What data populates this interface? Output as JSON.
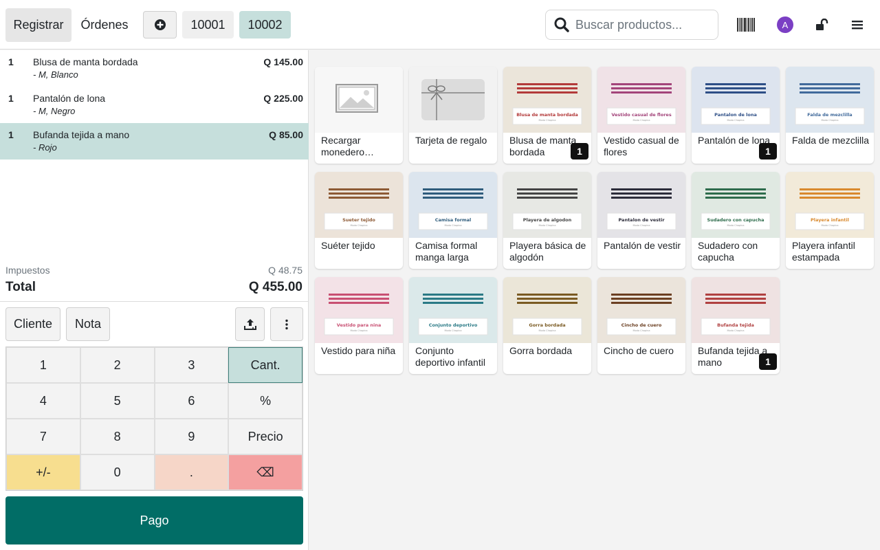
{
  "header": {
    "register_label": "Registrar",
    "orders_label": "Órdenes",
    "order_tabs": [
      "10001",
      "10002"
    ],
    "search_placeholder": "Buscar productos...",
    "avatar_initial": "A"
  },
  "order": {
    "lines": [
      {
        "qty": "1",
        "name": "Blusa de manta bordada",
        "attrs": "- M, Blanco",
        "price": "Q 145.00",
        "selected": false
      },
      {
        "qty": "1",
        "name": "Pantalón de lona",
        "attrs": "- M, Negro",
        "price": "Q 225.00",
        "selected": false
      },
      {
        "qty": "1",
        "name": "Bufanda tejida a mano",
        "attrs": "- Rojo",
        "price": "Q 85.00",
        "selected": true
      }
    ],
    "tax_label": "Impuestos",
    "tax_value": "Q 48.75",
    "total_label": "Total",
    "total_value": "Q 455.00"
  },
  "controls": {
    "customer_label": "Cliente",
    "note_label": "Nota"
  },
  "numpad": {
    "keys": [
      "1",
      "2",
      "3",
      "Cant.",
      "4",
      "5",
      "6",
      "%",
      "7",
      "8",
      "9",
      "Precio",
      "+/-",
      "0",
      ".",
      "⌫"
    ]
  },
  "pay_label": "Pago",
  "products": [
    {
      "name": "Recargar monedero…",
      "thumb_text": "",
      "accent": "",
      "qty_badge": ""
    },
    {
      "name": "Tarjeta de regalo",
      "thumb_text": "",
      "accent": "",
      "qty_badge": ""
    },
    {
      "name": "Blusa de manta bordada",
      "thumb_text": "Blusa de manta bordada",
      "accent": "#b33a3a",
      "bg": "#ebe5da",
      "qty_badge": "1"
    },
    {
      "name": "Vestido casual de flores",
      "thumb_text": "Vestido casual de flores",
      "accent": "#a3447a",
      "bg": "#f0e2e7",
      "qty_badge": ""
    },
    {
      "name": "Pantalón de lona",
      "thumb_text": "Pantalon de lona",
      "accent": "#2d4e86",
      "bg": "#dde4ef",
      "qty_badge": "1"
    },
    {
      "name": "Falda de mezclilla",
      "thumb_text": "Falda de mezclilla",
      "accent": "#416a9b",
      "bg": "#dde6ef",
      "qty_badge": ""
    },
    {
      "name": "Suéter tejido",
      "thumb_text": "Sueter tejido",
      "accent": "#8d5a35",
      "bg": "#ece3d9",
      "qty_badge": ""
    },
    {
      "name": "Camisa formal manga larga",
      "thumb_text": "Camisa formal",
      "accent": "#2f5c7c",
      "bg": "#dce5ee",
      "qty_badge": ""
    },
    {
      "name": "Playera básica de algodón",
      "thumb_text": "Playera de algodon",
      "accent": "#444444",
      "bg": "#e7e8e4",
      "qty_badge": ""
    },
    {
      "name": "Pantalón de vestir",
      "thumb_text": "Pantalon de vestir",
      "accent": "#2c2c3a",
      "bg": "#e4e3e7",
      "qty_badge": ""
    },
    {
      "name": "Sudadero con capucha",
      "thumb_text": "Sudadero con capucha",
      "accent": "#2e6c4c",
      "bg": "#e0e9e2",
      "qty_badge": ""
    },
    {
      "name": "Playera infantil estampada",
      "thumb_text": "Playera infantil",
      "accent": "#d9892d",
      "bg": "#f2ead9",
      "qty_badge": ""
    },
    {
      "name": "Vestido para niña",
      "thumb_text": "Vestido para nina",
      "accent": "#c84f72",
      "bg": "#f3e2e7",
      "qty_badge": ""
    },
    {
      "name": "Conjunto deportivo infantil",
      "thumb_text": "Conjunto deportivo",
      "accent": "#2a7a86",
      "bg": "#dbe9ea",
      "qty_badge": ""
    },
    {
      "name": "Gorra bordada",
      "thumb_text": "Gorra bordada",
      "accent": "#7a5a22",
      "bg": "#ebe6d8",
      "qty_badge": ""
    },
    {
      "name": "Cincho de cuero",
      "thumb_text": "Cincho de cuero",
      "accent": "#6b3f22",
      "bg": "#ebe4db",
      "qty_badge": ""
    },
    {
      "name": "Bufanda tejida a mano",
      "thumb_text": "Bufanda tejida",
      "accent": "#b04040",
      "bg": "#efe2e2",
      "qty_badge": "1"
    }
  ],
  "thumb_brand": "Moda Chapina",
  "colors": {
    "teal": "#016d66",
    "selected_bg": "#c6dfdc",
    "avatar": "#7b3fc4"
  }
}
